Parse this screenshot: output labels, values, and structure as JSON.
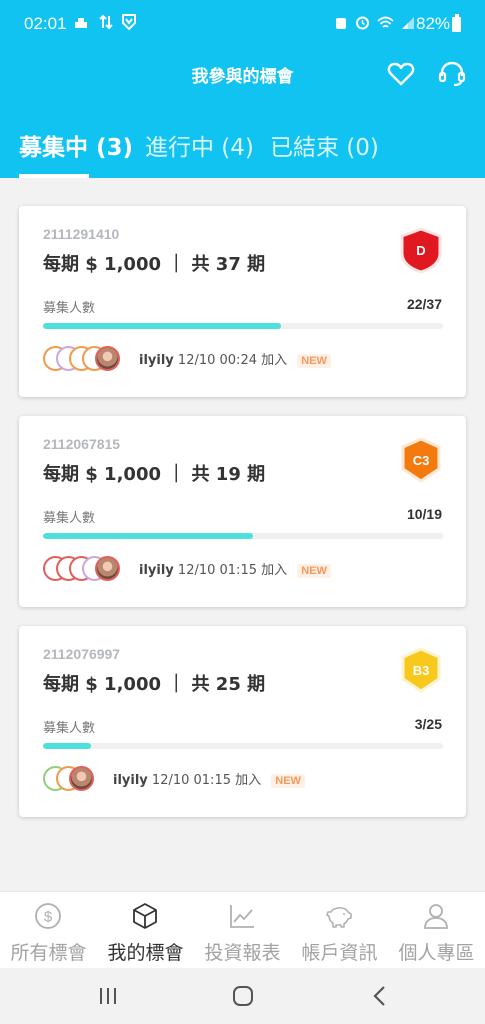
{
  "status_bar": {
    "time": "02:01",
    "battery": "82%",
    "left_icons": [
      "cloud-upload-icon",
      "transfer-icon",
      "shield-icon"
    ],
    "right_icons": [
      "alarm-clock-icon",
      "alarm-icon",
      "wifi-icon",
      "signal-icon",
      "battery-icon"
    ]
  },
  "header": {
    "title": "我參與的標會",
    "icons": [
      "heart-icon",
      "headset-icon"
    ]
  },
  "tabs": [
    {
      "label": "募集中 (3)",
      "active": true
    },
    {
      "label": "進行中 (4)",
      "active": false
    },
    {
      "label": "已結束 (0)",
      "active": false
    }
  ],
  "cards": [
    {
      "id": "2111291410",
      "amount": "每期 $ 1,000 ｜ 共 37 期",
      "badge": "D",
      "badge_color": "#e0181f",
      "recruit_label": "募集人數",
      "recruit_count": "22/37",
      "progress": 0.595,
      "username": "ilyily",
      "joined_text": "12/10 00:24 加入",
      "new_tag": "NEW"
    },
    {
      "id": "2112067815",
      "amount": "每期 $ 1,000 ｜ 共 19 期",
      "badge": "C3",
      "badge_color": "#f27a0f",
      "recruit_label": "募集人數",
      "recruit_count": "10/19",
      "progress": 0.526,
      "username": "ilyily",
      "joined_text": "12/10 01:15 加入",
      "new_tag": "NEW"
    },
    {
      "id": "2112076997",
      "amount": "每期 $ 1,000 ｜ 共 25 期",
      "badge": "B3",
      "badge_color": "#f8c81c",
      "recruit_label": "募集人數",
      "recruit_count": "3/25",
      "progress": 0.12,
      "username": "ilyily",
      "joined_text": "12/10 01:15 加入",
      "new_tag": "NEW"
    }
  ],
  "bottom_nav": [
    {
      "label": "所有標會",
      "icon": "dollar-coin-icon",
      "active": false
    },
    {
      "label": "我的標會",
      "icon": "cube-icon",
      "active": true
    },
    {
      "label": "投資報表",
      "icon": "line-chart-icon",
      "active": false
    },
    {
      "label": "帳戶資訊",
      "icon": "piggy-bank-icon",
      "active": false
    },
    {
      "label": "個人專區",
      "icon": "user-icon",
      "active": false
    }
  ],
  "colors": {
    "brand": "#10c3f1",
    "progress": "#4ee0dc",
    "new_tag": "#f59a5a"
  }
}
